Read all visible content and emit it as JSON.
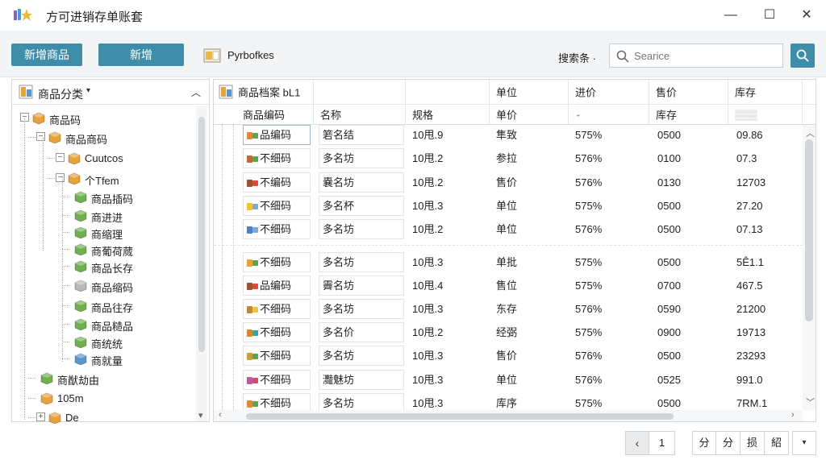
{
  "window": {
    "title": "方可进销存单账套",
    "min": "—",
    "max": "☐",
    "close": "✕"
  },
  "toolbar": {
    "new_product_label": "新增商品",
    "new_label": "新增",
    "file_label": "Pyrbofkes",
    "search_label": "搜索条 ·",
    "search_placeholder": "Searice"
  },
  "tree": {
    "header": "商品分类",
    "nodes": [
      {
        "label": "商品码",
        "level": 0,
        "toggle": "⊟",
        "color": "#e8a23a"
      },
      {
        "label": "商品商码",
        "level": 1,
        "toggle": "⊟",
        "color": "#e8a23a"
      },
      {
        "label": "Cuutcos",
        "level": 2,
        "toggle": "⊟",
        "color": "#e8a23a"
      },
      {
        "label": "个Tfem",
        "level": 2,
        "toggle": "⊟",
        "color": "#e8a23a"
      },
      {
        "label": "商品插码",
        "level": 3,
        "toggle": "",
        "color": "#6fb04f"
      },
      {
        "label": "商进进",
        "level": 3,
        "toggle": "",
        "color": "#6fb04f"
      },
      {
        "label": "商缩理",
        "level": 3,
        "toggle": "",
        "color": "#6fb04f"
      },
      {
        "label": "商葡荷蒇",
        "level": 3,
        "toggle": "",
        "color": "#6fb04f"
      },
      {
        "label": "商品长存",
        "level": 3,
        "toggle": "",
        "color": "#6fb04f"
      },
      {
        "label": "商品缩码",
        "level": 3,
        "toggle": "",
        "color": "#b8b8b8"
      },
      {
        "label": "商品往存",
        "level": 3,
        "toggle": "",
        "color": "#6fb04f"
      },
      {
        "label": "商品糙品",
        "level": 3,
        "toggle": "",
        "color": "#6fb04f"
      },
      {
        "label": "商统统",
        "level": 3,
        "toggle": "",
        "color": "#6fb04f"
      },
      {
        "label": "商就量",
        "level": 3,
        "toggle": "",
        "color": "#5c95c9"
      },
      {
        "label": "商猷劫由",
        "level": 1,
        "toggle": "",
        "color": "#6fb04f"
      },
      {
        "label": "105m",
        "level": 1,
        "toggle": "",
        "color": "#e8a23a"
      },
      {
        "label": "De",
        "level": 1,
        "toggle": "⊞",
        "color": "#e8a23a"
      }
    ]
  },
  "grid": {
    "top_header": [
      "商品档案 bL1",
      "",
      "",
      "单位",
      "进价",
      "售价",
      "库存"
    ],
    "columns": [
      "商品编码",
      "名称",
      "规格",
      "单价",
      "",
      "库存",
      "▒▒▒"
    ],
    "rows": [
      {
        "code": "品编码",
        "name": "箬名结",
        "spec": "10甩.9",
        "unit": "隼致",
        "price": "575%",
        "stock": "0500",
        "extra": "09.86",
        "dot": "#e08a3c",
        "leaf": "#5aa64f"
      },
      {
        "code": "不细码",
        "name": "多名坊",
        "spec": "10甩.2",
        "unit": "参拉",
        "price": "576%",
        "stock": "0100",
        "extra": "07.3",
        "dot": "#c06a3a",
        "leaf": "#5aa64f"
      },
      {
        "code": "不编码",
        "name": "嚢名坊",
        "spec": "10甩.2",
        "unit": "售价",
        "price": "576%",
        "stock": "0130",
        "extra": "12703",
        "dot": "#a0522d",
        "leaf": "#d94a3a"
      },
      {
        "code": "不细码",
        "name": "多名杯",
        "spec": "10甩.3",
        "unit": "单位",
        "price": "575%",
        "stock": "0500",
        "extra": "27.20",
        "dot": "#f0c23c",
        "leaf": "#7aa8d8"
      },
      {
        "code": "不细码",
        "name": "多名坊",
        "spec": "10甩.2",
        "unit": "单位",
        "price": "576%",
        "stock": "0500",
        "extra": "07.13",
        "dot": "#4f7fc0",
        "leaf": "#7aa8d8"
      },
      {
        "code": "不细码",
        "name": "多名坊",
        "spec": "10甩.3",
        "unit": "单批",
        "price": "575%",
        "stock": "0500",
        "extra": "5Ê1.1",
        "dot": "#e8a23a",
        "leaf": "#5aa64f"
      },
      {
        "code": "品编码",
        "name": "霽名坊",
        "spec": "10甩.4",
        "unit": "售位",
        "price": "575%",
        "stock": "0700",
        "extra": "467.5",
        "dot": "#a0522d",
        "leaf": "#d94a3a"
      },
      {
        "code": "不细码",
        "name": "多名坊",
        "spec": "10甩.3",
        "unit": "东存",
        "price": "576%",
        "stock": "0590",
        "extra": "21200",
        "dot": "#c08a3a",
        "leaf": "#f0c23c"
      },
      {
        "code": "不细码",
        "name": "多名价",
        "spec": "10甩.2",
        "unit": "经弼",
        "price": "575%",
        "stock": "0900",
        "extra": "19713",
        "dot": "#d08a3c",
        "leaf": "#3aa0a0"
      },
      {
        "code": "不细码",
        "name": "多名坊",
        "spec": "10甩.3",
        "unit": "售价",
        "price": "576%",
        "stock": "0500",
        "extra": "23293",
        "dot": "#c8a03a",
        "leaf": "#5aa64f"
      },
      {
        "code": "不细码",
        "name": "灩魅坊",
        "spec": "10甩.3",
        "unit": "单位",
        "price": "576%",
        "stock": "0525",
        "extra": "991.0",
        "dot": "#c05a9a",
        "leaf": "#d94a6a"
      },
      {
        "code": "不细码",
        "name": "多名坊",
        "spec": "10甩.3",
        "unit": "库序",
        "price": "575%",
        "stock": "0500",
        "extra": "7RM.1",
        "dot": "#e08a3c",
        "leaf": "#5aa64f"
      }
    ]
  },
  "pager": {
    "prev": "‹",
    "page": "1",
    "options": [
      "分",
      "分",
      "损",
      "紹"
    ],
    "more": "▾"
  },
  "colors": {
    "accent": "#3f8ea9",
    "border": "#d3d8dd"
  }
}
